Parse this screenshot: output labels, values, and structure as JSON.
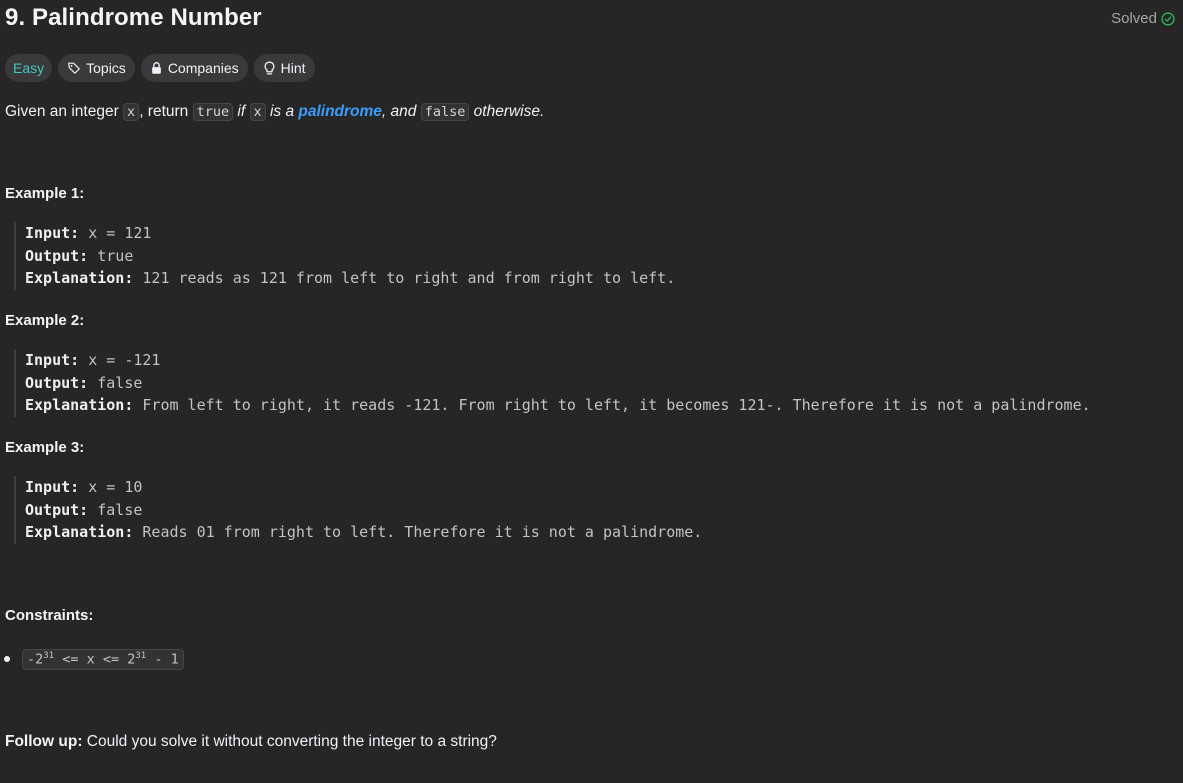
{
  "problem": {
    "title": "9. Palindrome Number",
    "status": "Solved"
  },
  "tags": {
    "difficulty": "Easy",
    "topics": "Topics",
    "companies": "Companies",
    "hint": "Hint"
  },
  "description": {
    "t1": "Given an integer ",
    "c1": "x",
    "t2": ", return ",
    "c2": "true",
    "t3": " if ",
    "c3": "x",
    "t4": " is a ",
    "link": "palindrome",
    "t5": ", and ",
    "c4": "false",
    "t6": " otherwise."
  },
  "examples": [
    {
      "title": "Example 1:",
      "input_label": "Input:",
      "input": " x = 121",
      "output_label": "Output:",
      "output": " true",
      "explanation_label": "Explanation:",
      "explanation": " 121 reads as 121 from left to right and from right to left."
    },
    {
      "title": "Example 2:",
      "input_label": "Input:",
      "input": " x = -121",
      "output_label": "Output:",
      "output": " false",
      "explanation_label": "Explanation:",
      "explanation": " From left to right, it reads -121. From right to left, it becomes 121-. Therefore it is not a palindrome."
    },
    {
      "title": "Example 3:",
      "input_label": "Input:",
      "input": " x = 10",
      "output_label": "Output:",
      "output": " false",
      "explanation_label": "Explanation:",
      "explanation": " Reads 01 from right to left. Therefore it is not a palindrome."
    }
  ],
  "constraints": {
    "title": "Constraints:",
    "items": [
      {
        "neg": "-2",
        "exp1": "31",
        "mid": " <= x <= 2",
        "exp2": "31",
        "tail": " - 1"
      }
    ]
  },
  "follow_up": {
    "label": "Follow up:",
    "text": " Could you solve it without converting the integer to a string?"
  },
  "colors": {
    "background": "#262626",
    "easy": "#46c6c2",
    "solved_check": "#2cbb5d",
    "link": "#3b9dff"
  },
  "icons": {
    "solved": "check-circle-icon",
    "topics": "tag-icon",
    "companies": "lock-icon",
    "hint": "lightbulb-icon"
  }
}
